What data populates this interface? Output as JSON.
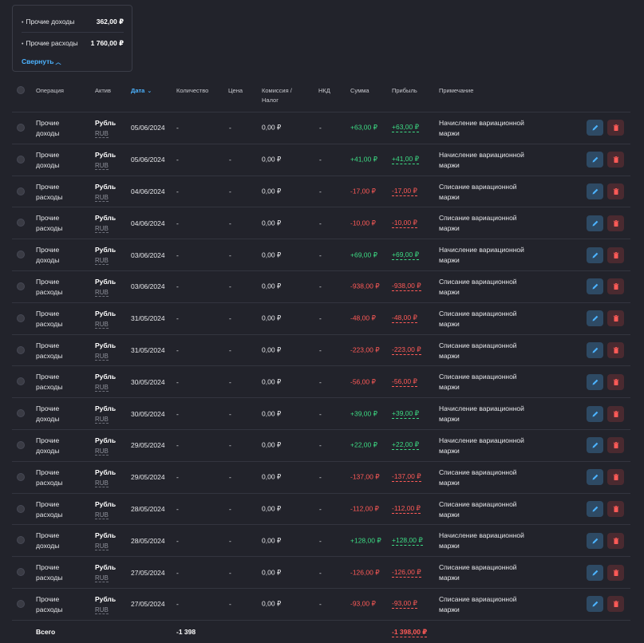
{
  "summary": {
    "items": [
      {
        "name": "Прочие доходы",
        "value": "362,00 ₽"
      },
      {
        "name": "Прочие расходы",
        "value": "1 760,00 ₽"
      }
    ],
    "collapse_label": "Свернуть"
  },
  "table": {
    "headers": {
      "operation": "Операция",
      "asset": "Актив",
      "date": "Дата",
      "quantity": "Количество",
      "price": "Цена",
      "commission_line1": "Комиссия /",
      "commission_line2": "Налог",
      "nkd": "НКД",
      "sum": "Сумма",
      "profit": "Прибыль",
      "note": "Примечание"
    },
    "rows": [
      {
        "op1": "Прочие",
        "op2": "доходы",
        "asset": "Рубль",
        "code": "RUB",
        "date": "05/06/2024",
        "qty": "-",
        "price": "-",
        "commission": "0,00 ₽",
        "nkd": "-",
        "sum": "+63,00 ₽",
        "profit": "+63,00 ₽",
        "sign": "pos",
        "note1": "Начисление вариационной",
        "note2": "маржи"
      },
      {
        "op1": "Прочие",
        "op2": "доходы",
        "asset": "Рубль",
        "code": "RUB",
        "date": "05/06/2024",
        "qty": "-",
        "price": "-",
        "commission": "0,00 ₽",
        "nkd": "-",
        "sum": "+41,00 ₽",
        "profit": "+41,00 ₽",
        "sign": "pos",
        "note1": "Начисление вариационной",
        "note2": "маржи"
      },
      {
        "op1": "Прочие",
        "op2": "расходы",
        "asset": "Рубль",
        "code": "RUB",
        "date": "04/06/2024",
        "qty": "-",
        "price": "-",
        "commission": "0,00 ₽",
        "nkd": "-",
        "sum": "-17,00 ₽",
        "profit": "-17,00 ₽",
        "sign": "neg",
        "note1": "Списание вариационной",
        "note2": "маржи"
      },
      {
        "op1": "Прочие",
        "op2": "расходы",
        "asset": "Рубль",
        "code": "RUB",
        "date": "04/06/2024",
        "qty": "-",
        "price": "-",
        "commission": "0,00 ₽",
        "nkd": "-",
        "sum": "-10,00 ₽",
        "profit": "-10,00 ₽",
        "sign": "neg",
        "note1": "Списание вариационной",
        "note2": "маржи"
      },
      {
        "op1": "Прочие",
        "op2": "доходы",
        "asset": "Рубль",
        "code": "RUB",
        "date": "03/06/2024",
        "qty": "-",
        "price": "-",
        "commission": "0,00 ₽",
        "nkd": "-",
        "sum": "+69,00 ₽",
        "profit": "+69,00 ₽",
        "sign": "pos",
        "note1": "Начисление вариационной",
        "note2": "маржи"
      },
      {
        "op1": "Прочие",
        "op2": "расходы",
        "asset": "Рубль",
        "code": "RUB",
        "date": "03/06/2024",
        "qty": "-",
        "price": "-",
        "commission": "0,00 ₽",
        "nkd": "-",
        "sum": "-938,00 ₽",
        "profit": "-938,00 ₽",
        "sign": "neg",
        "note1": "Списание вариационной",
        "note2": "маржи"
      },
      {
        "op1": "Прочие",
        "op2": "расходы",
        "asset": "Рубль",
        "code": "RUB",
        "date": "31/05/2024",
        "qty": "-",
        "price": "-",
        "commission": "0,00 ₽",
        "nkd": "-",
        "sum": "-48,00 ₽",
        "profit": "-48,00 ₽",
        "sign": "neg",
        "note1": "Списание вариационной",
        "note2": "маржи"
      },
      {
        "op1": "Прочие",
        "op2": "расходы",
        "asset": "Рубль",
        "code": "RUB",
        "date": "31/05/2024",
        "qty": "-",
        "price": "-",
        "commission": "0,00 ₽",
        "nkd": "-",
        "sum": "-223,00 ₽",
        "profit": "-223,00 ₽",
        "sign": "neg",
        "note1": "Списание вариационной",
        "note2": "маржи"
      },
      {
        "op1": "Прочие",
        "op2": "расходы",
        "asset": "Рубль",
        "code": "RUB",
        "date": "30/05/2024",
        "qty": "-",
        "price": "-",
        "commission": "0,00 ₽",
        "nkd": "-",
        "sum": "-56,00 ₽",
        "profit": "-56,00 ₽",
        "sign": "neg",
        "note1": "Списание вариационной",
        "note2": "маржи"
      },
      {
        "op1": "Прочие",
        "op2": "доходы",
        "asset": "Рубль",
        "code": "RUB",
        "date": "30/05/2024",
        "qty": "-",
        "price": "-",
        "commission": "0,00 ₽",
        "nkd": "-",
        "sum": "+39,00 ₽",
        "profit": "+39,00 ₽",
        "sign": "pos",
        "note1": "Начисление вариационной",
        "note2": "маржи"
      },
      {
        "op1": "Прочие",
        "op2": "доходы",
        "asset": "Рубль",
        "code": "RUB",
        "date": "29/05/2024",
        "qty": "-",
        "price": "-",
        "commission": "0,00 ₽",
        "nkd": "-",
        "sum": "+22,00 ₽",
        "profit": "+22,00 ₽",
        "sign": "pos",
        "note1": "Начисление вариационной",
        "note2": "маржи"
      },
      {
        "op1": "Прочие",
        "op2": "расходы",
        "asset": "Рубль",
        "code": "RUB",
        "date": "29/05/2024",
        "qty": "-",
        "price": "-",
        "commission": "0,00 ₽",
        "nkd": "-",
        "sum": "-137,00 ₽",
        "profit": "-137,00 ₽",
        "sign": "neg",
        "note1": "Списание вариационной",
        "note2": "маржи"
      },
      {
        "op1": "Прочие",
        "op2": "расходы",
        "asset": "Рубль",
        "code": "RUB",
        "date": "28/05/2024",
        "qty": "-",
        "price": "-",
        "commission": "0,00 ₽",
        "nkd": "-",
        "sum": "-112,00 ₽",
        "profit": "-112,00 ₽",
        "sign": "neg",
        "note1": "Списание вариационной",
        "note2": "маржи"
      },
      {
        "op1": "Прочие",
        "op2": "доходы",
        "asset": "Рубль",
        "code": "RUB",
        "date": "28/05/2024",
        "qty": "-",
        "price": "-",
        "commission": "0,00 ₽",
        "nkd": "-",
        "sum": "+128,00 ₽",
        "profit": "+128,00 ₽",
        "sign": "pos",
        "note1": "Начисление вариационной",
        "note2": "маржи"
      },
      {
        "op1": "Прочие",
        "op2": "расходы",
        "asset": "Рубль",
        "code": "RUB",
        "date": "27/05/2024",
        "qty": "-",
        "price": "-",
        "commission": "0,00 ₽",
        "nkd": "-",
        "sum": "-126,00 ₽",
        "profit": "-126,00 ₽",
        "sign": "neg",
        "note1": "Списание вариационной",
        "note2": "маржи"
      },
      {
        "op1": "Прочие",
        "op2": "расходы",
        "asset": "Рубль",
        "code": "RUB",
        "date": "27/05/2024",
        "qty": "-",
        "price": "-",
        "commission": "0,00 ₽",
        "nkd": "-",
        "sum": "-93,00 ₽",
        "profit": "-93,00 ₽",
        "sign": "neg",
        "note1": "Списание вариационной",
        "note2": "маржи"
      }
    ],
    "footer": {
      "label": "Всего",
      "quantity_total": "-1 398",
      "profit_total": "-1 398,00 ₽"
    }
  },
  "colors": {
    "positive": "#3ddc84",
    "negative": "#ff5a57",
    "accent": "#4cb3ff"
  }
}
